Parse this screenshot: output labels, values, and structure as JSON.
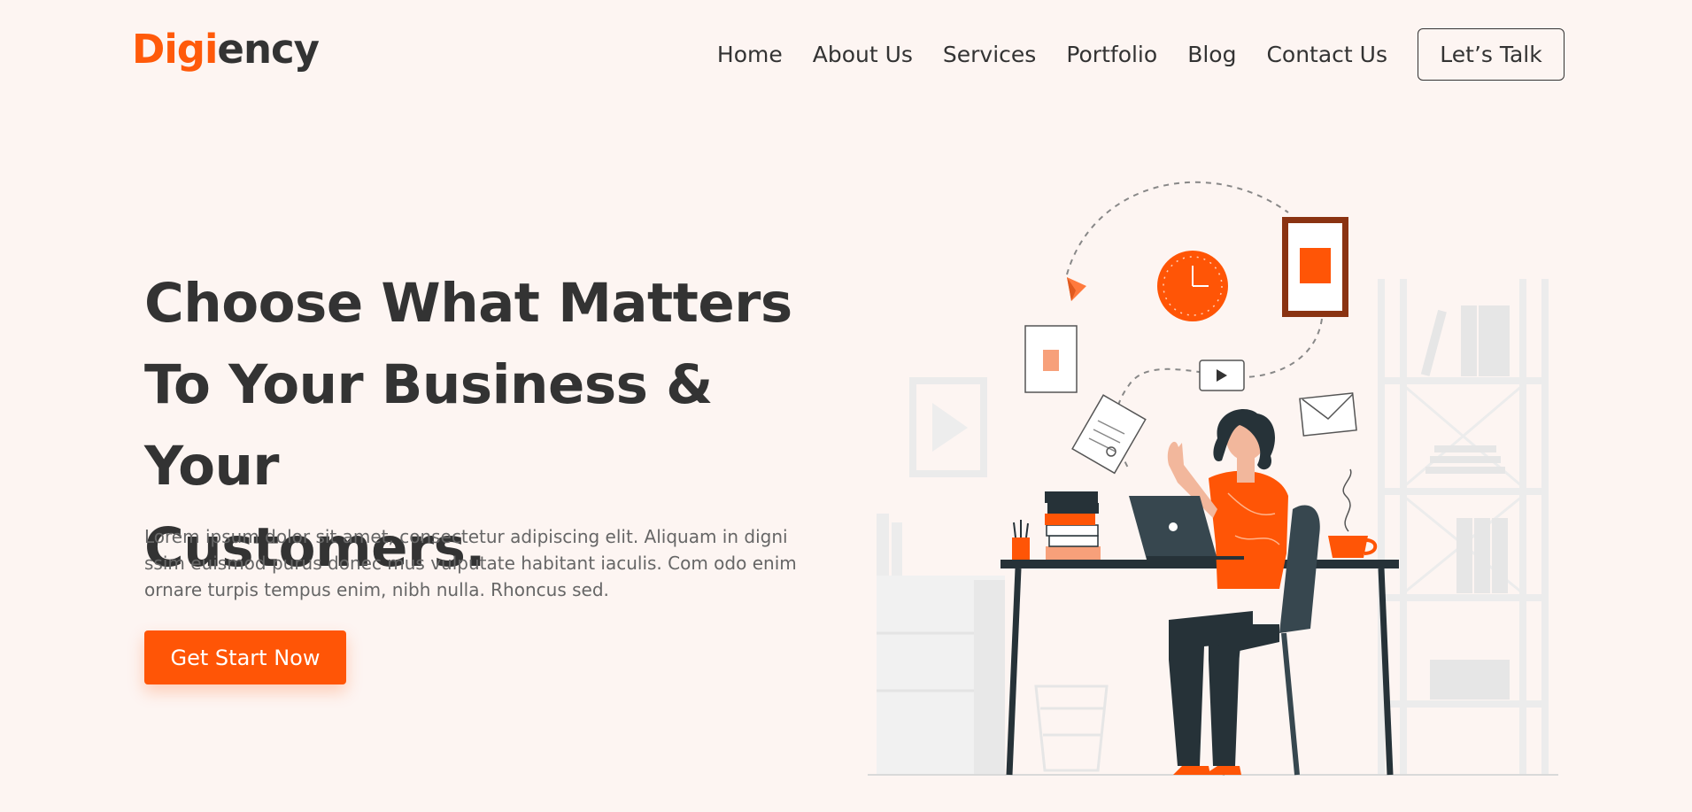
{
  "brand": {
    "logo_accent": "Digi",
    "logo_rest": "ency",
    "accent_color": "#ff5a0a"
  },
  "nav": {
    "items": [
      "Home",
      "About Us",
      "Services",
      "Portfolio",
      "Blog",
      "Contact Us"
    ],
    "cta_label": "Let’s Talk"
  },
  "hero": {
    "title_lines": [
      "Choose What Matters",
      "To Your Business & Your",
      "Customers."
    ],
    "description": "Lorem ipsum dolor sit amet, consectetur adipiscing elit. Aliquam in digni ssim euismod purus donec mus vulputate habitant iaculis. Com odo enim ornare turpis tempus enim, nibh nulla. Rhoncus sed.",
    "cta_label": "Get Start Now",
    "cta_color": "#ff5506"
  },
  "illustration": {
    "icons": [
      "clock-icon",
      "picture-frame-icon",
      "play-icon",
      "envelope-icon",
      "document-icon",
      "paper-plane-icon",
      "laptop-icon",
      "coffee-cup-icon",
      "books-icon",
      "pencil-cup-icon"
    ]
  }
}
